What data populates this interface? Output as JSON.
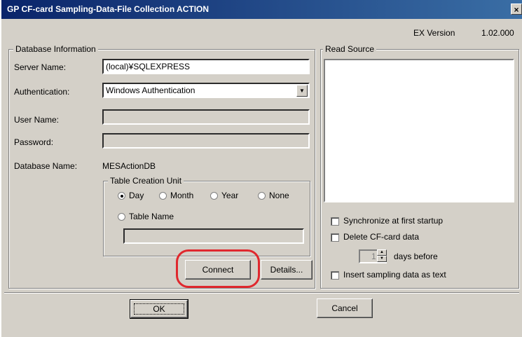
{
  "window": {
    "title": "GP CF-card Sampling-Data-File Collection ACTION",
    "close_icon": "×",
    "version_label": "EX Version",
    "version_number": "1.02.000"
  },
  "db_info": {
    "group_label": "Database Information",
    "server_name_label": "Server Name:",
    "server_name_value": "(local)¥SQLEXPRESS",
    "auth_label": "Authentication:",
    "auth_value": "Windows Authentication",
    "user_name_label": "User Name:",
    "user_name_value": "",
    "password_label": "Password:",
    "password_value": "",
    "db_name_label": "Database Name:",
    "db_name_value": "MESActionDB"
  },
  "table_unit": {
    "group_label": "Table Creation Unit",
    "day": "Day",
    "month": "Month",
    "year": "Year",
    "none": "None",
    "table_name": "Table Name",
    "table_name_value": "",
    "selected": "Day"
  },
  "buttons": {
    "connect": "Connect",
    "details": "Details...",
    "ok": "OK",
    "cancel": "Cancel"
  },
  "read_source": {
    "group_label": "Read Source"
  },
  "options": {
    "sync_label": "Synchronize at first startup",
    "delete_label": "Delete CF-card data",
    "days_value": "1",
    "days_label": "days before",
    "insert_label": "Insert sampling data as text"
  },
  "colors": {
    "title_gradient_start": "#0a246a",
    "highlight": "#e0282e"
  }
}
